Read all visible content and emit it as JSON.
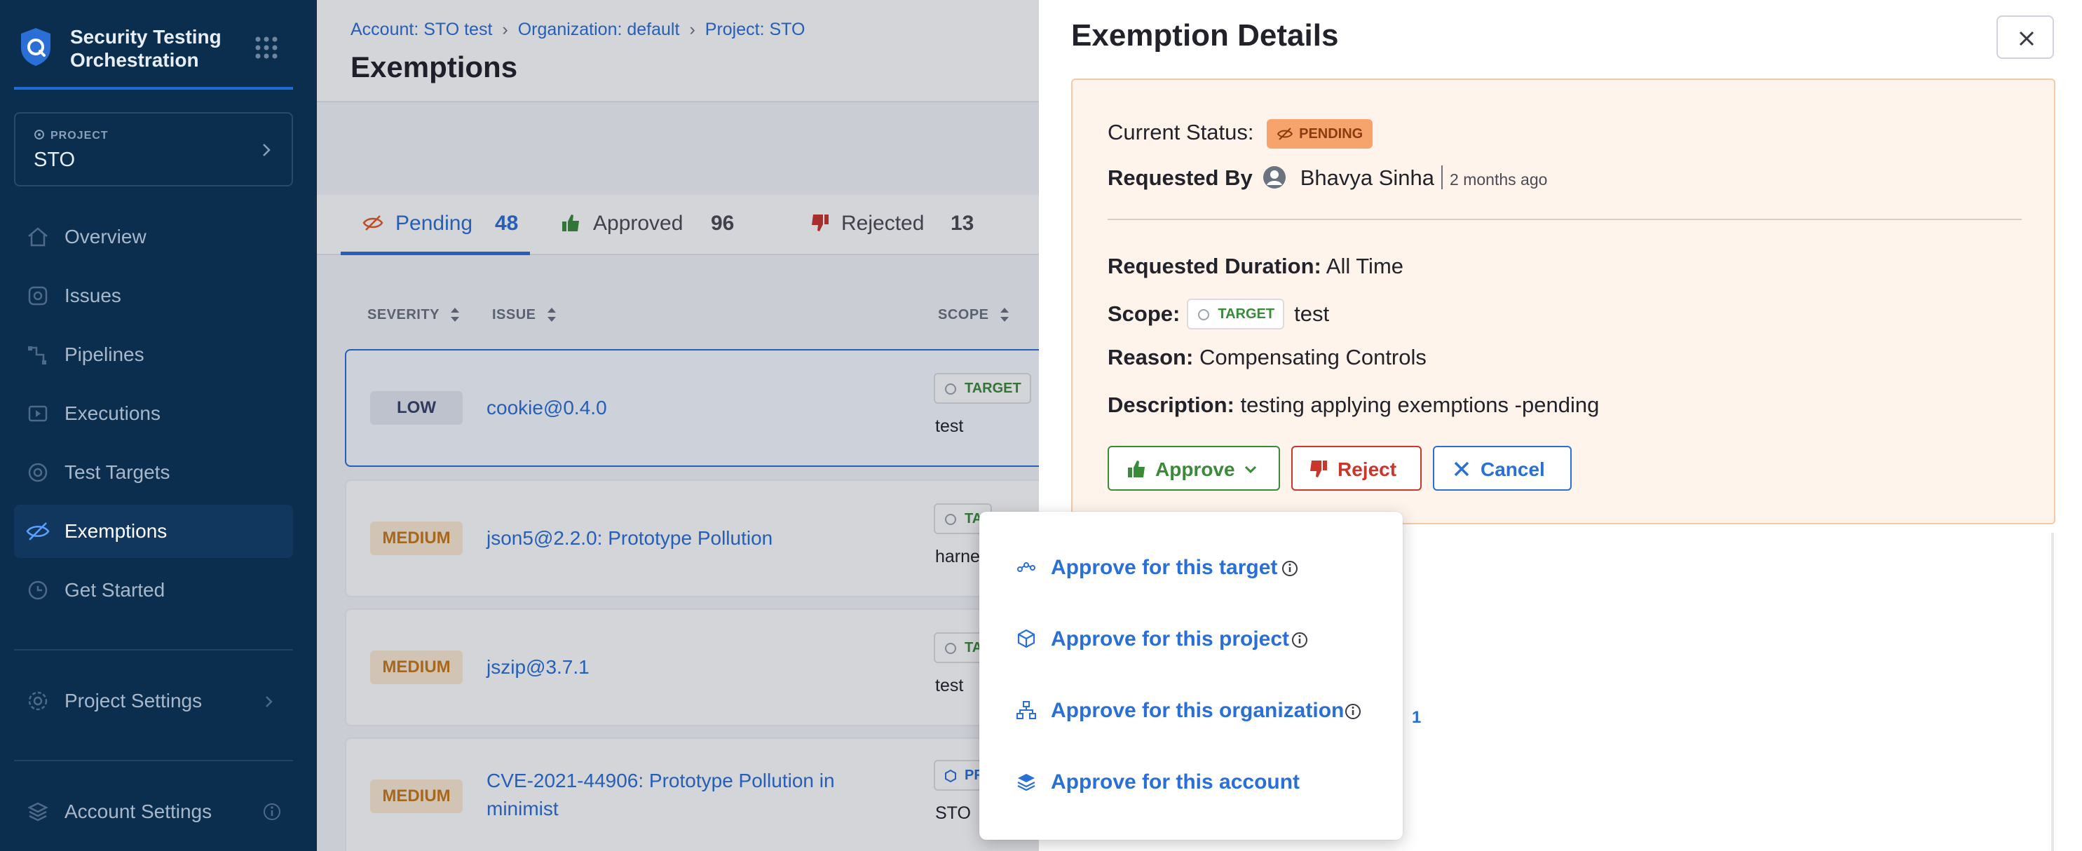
{
  "sidebar": {
    "brand_title": "Security Testing Orchestration",
    "project_label": "PROJECT",
    "project_name": "STO",
    "items": [
      {
        "label": "Overview",
        "icon": "home-icon"
      },
      {
        "label": "Issues",
        "icon": "issues-icon"
      },
      {
        "label": "Pipelines",
        "icon": "pipelines-icon"
      },
      {
        "label": "Executions",
        "icon": "executions-icon"
      },
      {
        "label": "Test Targets",
        "icon": "target-icon"
      },
      {
        "label": "Exemptions",
        "icon": "eye-off-icon",
        "active": true
      },
      {
        "label": "Get Started",
        "icon": "get-started-icon"
      }
    ],
    "project_settings": "Project Settings",
    "account_settings": "Account Settings"
  },
  "header": {
    "breadcrumb": [
      "Account: STO test",
      "Organization: default",
      "Project: STO"
    ],
    "title": "Exemptions"
  },
  "tabs": [
    {
      "label": "Pending",
      "count": "48",
      "active": true
    },
    {
      "label": "Approved",
      "count": "96"
    },
    {
      "label": "Rejected",
      "count": "13"
    }
  ],
  "table": {
    "columns": [
      "SEVERITY",
      "ISSUE",
      "SCOPE"
    ],
    "rows": [
      {
        "severity": "LOW",
        "issue": "cookie@0.4.0",
        "scope_type": "TARGET",
        "scope_name": "test"
      },
      {
        "severity": "MEDIUM",
        "issue": "json5@2.2.0: Prototype Pollution",
        "scope_type": "TA",
        "scope_name": "harnes"
      },
      {
        "severity": "MEDIUM",
        "issue": "jszip@3.7.1",
        "scope_type": "TA",
        "scope_name": "test"
      },
      {
        "severity": "MEDIUM",
        "issue_line1": "CVE-2021-44906: Prototype Pollution in",
        "issue_line2": "minimist",
        "scope_type": "PR",
        "scope_name": "STO"
      }
    ]
  },
  "drawer": {
    "title": "Exemption Details",
    "current_status_label": "Current Status:",
    "status": "PENDING",
    "requested_by_label": "Requested By",
    "requester": "Bhavya Sinha",
    "requested_ago": "2 months ago",
    "duration_label": "Requested Duration:",
    "duration": "All Time",
    "scope_label": "Scope:",
    "scope_type": "TARGET",
    "scope_name": "test",
    "reason_label": "Reason:",
    "reason": "Compensating Controls",
    "description_label": "Description:",
    "description": "testing applying exemptions -pending",
    "approve_label": "Approve",
    "reject_label": "Reject",
    "cancel_label": "Cancel",
    "partial_badge": "1"
  },
  "approve_menu": [
    {
      "label": "Approve for this target",
      "icon": "target-icon"
    },
    {
      "label": "Approve for this project",
      "icon": "cube-icon"
    },
    {
      "label": "Approve for this organization",
      "icon": "organization-icon"
    },
    {
      "label": "Approve for this account",
      "icon": "layers-icon"
    }
  ],
  "colors": {
    "sidebar_bg": "#0b2d4e",
    "accent": "#2a6fd6",
    "approve": "#3a8a3a",
    "reject": "#c8362c",
    "pending_badge": "#f7a46c",
    "details_bg": "#fff4ec"
  }
}
